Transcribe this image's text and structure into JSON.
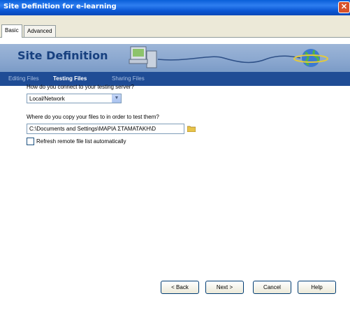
{
  "window": {
    "title": "Site Definition for e-learning",
    "close_glyph": "✕"
  },
  "tabs": [
    {
      "label": "Basic"
    },
    {
      "label": "Advanced"
    }
  ],
  "banner": {
    "heading": "Site Definition"
  },
  "subnav": [
    {
      "label": "Editing Files"
    },
    {
      "label": "Testing Files"
    },
    {
      "label": "Sharing Files"
    }
  ],
  "form": {
    "connect_question": "How do you connect to your testing server?",
    "connect_value": "Local/Network",
    "copy_question": "Where do you copy your files to in order to test them?",
    "path_value": "C:\\Documents and Settings\\ΜΑΡΙΑ ΣΤΑΜΑΤΑΚΗ\\D",
    "refresh_label": "Refresh remote file list automatically"
  },
  "buttons": {
    "back": "< Back",
    "next": "Next >",
    "cancel": "Cancel",
    "help": "Help"
  },
  "colors": {
    "titlebar": "#0a5fd8",
    "banner": "#8aa7cf",
    "subnav": "#1f4c95",
    "heading": "#17407f"
  },
  "icons": [
    "close-icon",
    "computer-icon",
    "globe-icon",
    "folder-icon",
    "chevron-down-icon"
  ]
}
